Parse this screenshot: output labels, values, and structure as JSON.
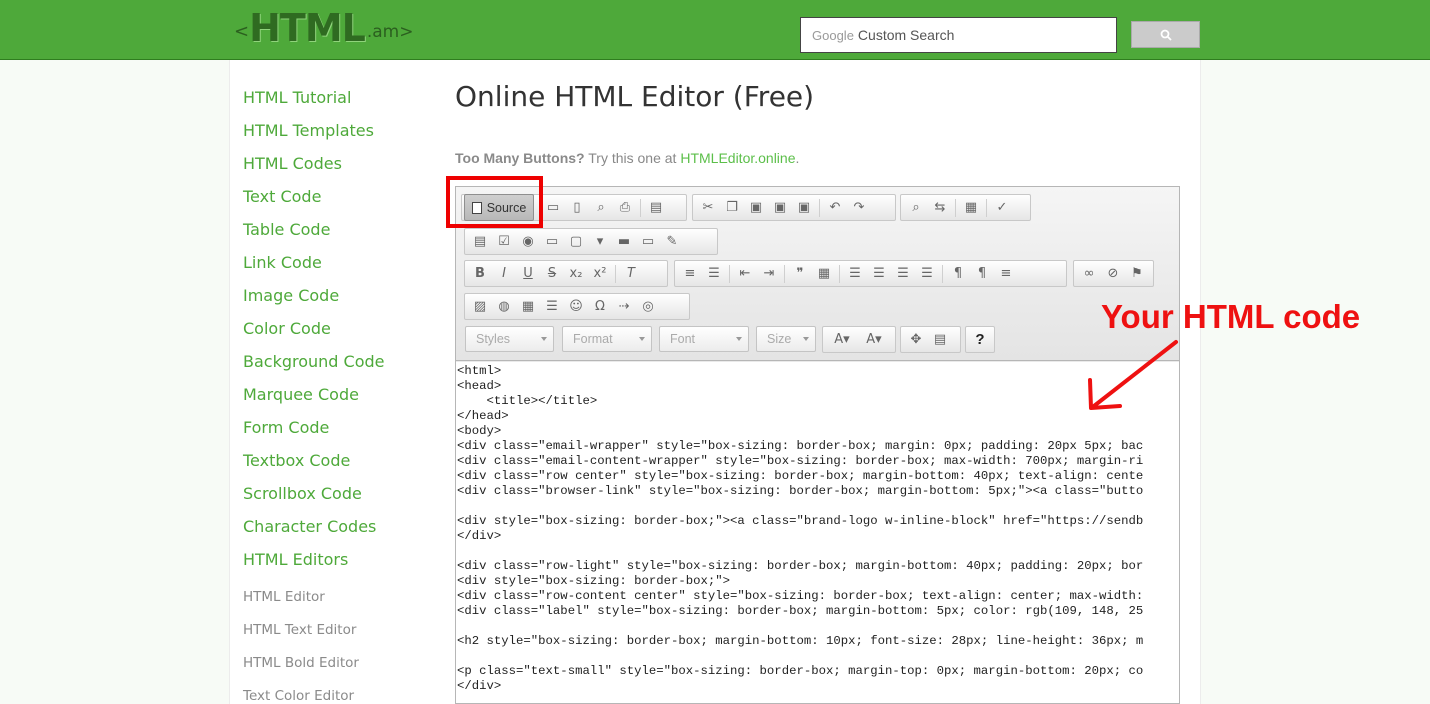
{
  "header": {
    "logo": {
      "open": "<",
      "word": "HTML",
      "tld": ".am>"
    },
    "search": {
      "brand": "Google",
      "placeholder": "Custom Search"
    },
    "search_button_icon": "search-icon"
  },
  "sidebar": {
    "links": [
      "HTML Tutorial",
      "HTML Templates",
      "HTML Codes",
      "Text Code",
      "Table Code",
      "Link Code",
      "Image Code",
      "Color Code",
      "Background Code",
      "Marquee Code",
      "Form Code",
      "Textbox Code",
      "Scrollbox Code",
      "Character Codes",
      "HTML Editors"
    ],
    "sub_links": [
      "HTML Editor",
      "HTML Text Editor",
      "HTML Bold Editor",
      "Text Color Editor"
    ]
  },
  "main": {
    "title": "Online HTML Editor (Free)",
    "tip": {
      "bold": "Too Many Buttons?",
      "text": " Try this one at ",
      "link": "HTMLEditor.online",
      "end": "."
    }
  },
  "editor": {
    "source_label": "Source",
    "combos": {
      "styles": "Styles",
      "format": "Format",
      "font": "Font",
      "size": "Size"
    },
    "help_label": "?",
    "code_lines": [
      "<html>",
      "<head>",
      "    <title></title>",
      "</head>",
      "<body>",
      "<div class=\"email-wrapper\" style=\"box-sizing: border-box; margin: 0px; padding: 20px 5px; bac",
      "<div class=\"email-content-wrapper\" style=\"box-sizing: border-box; max-width: 700px; margin-ri",
      "<div class=\"row center\" style=\"box-sizing: border-box; margin-bottom: 40px; text-align: cente",
      "<div class=\"browser-link\" style=\"box-sizing: border-box; margin-bottom: 5px;\"><a class=\"butto",
      "",
      "<div style=\"box-sizing: border-box;\"><a class=\"brand-logo w-inline-block\" href=\"https://sendb",
      "</div>",
      "",
      "<div class=\"row-light\" style=\"box-sizing: border-box; margin-bottom: 40px; padding: 20px; bor",
      "<div style=\"box-sizing: border-box;\">",
      "<div class=\"row-content center\" style=\"box-sizing: border-box; text-align: center; max-width:",
      "<div class=\"label\" style=\"box-sizing: border-box; margin-bottom: 5px; color: rgb(109, 148, 25",
      "",
      "<h2 style=\"box-sizing: border-box; margin-bottom: 10px; font-size: 28px; line-height: 36px; m",
      "",
      "<p class=\"text-small\" style=\"box-sizing: border-box; margin-top: 0px; margin-bottom: 20px; co",
      "</div>"
    ]
  },
  "annotation": {
    "text": "Your HTML code",
    "color": "#e11111"
  },
  "colors": {
    "header": "#4ea93a",
    "link": "#4ea93a",
    "accent_red": "#e00000"
  }
}
